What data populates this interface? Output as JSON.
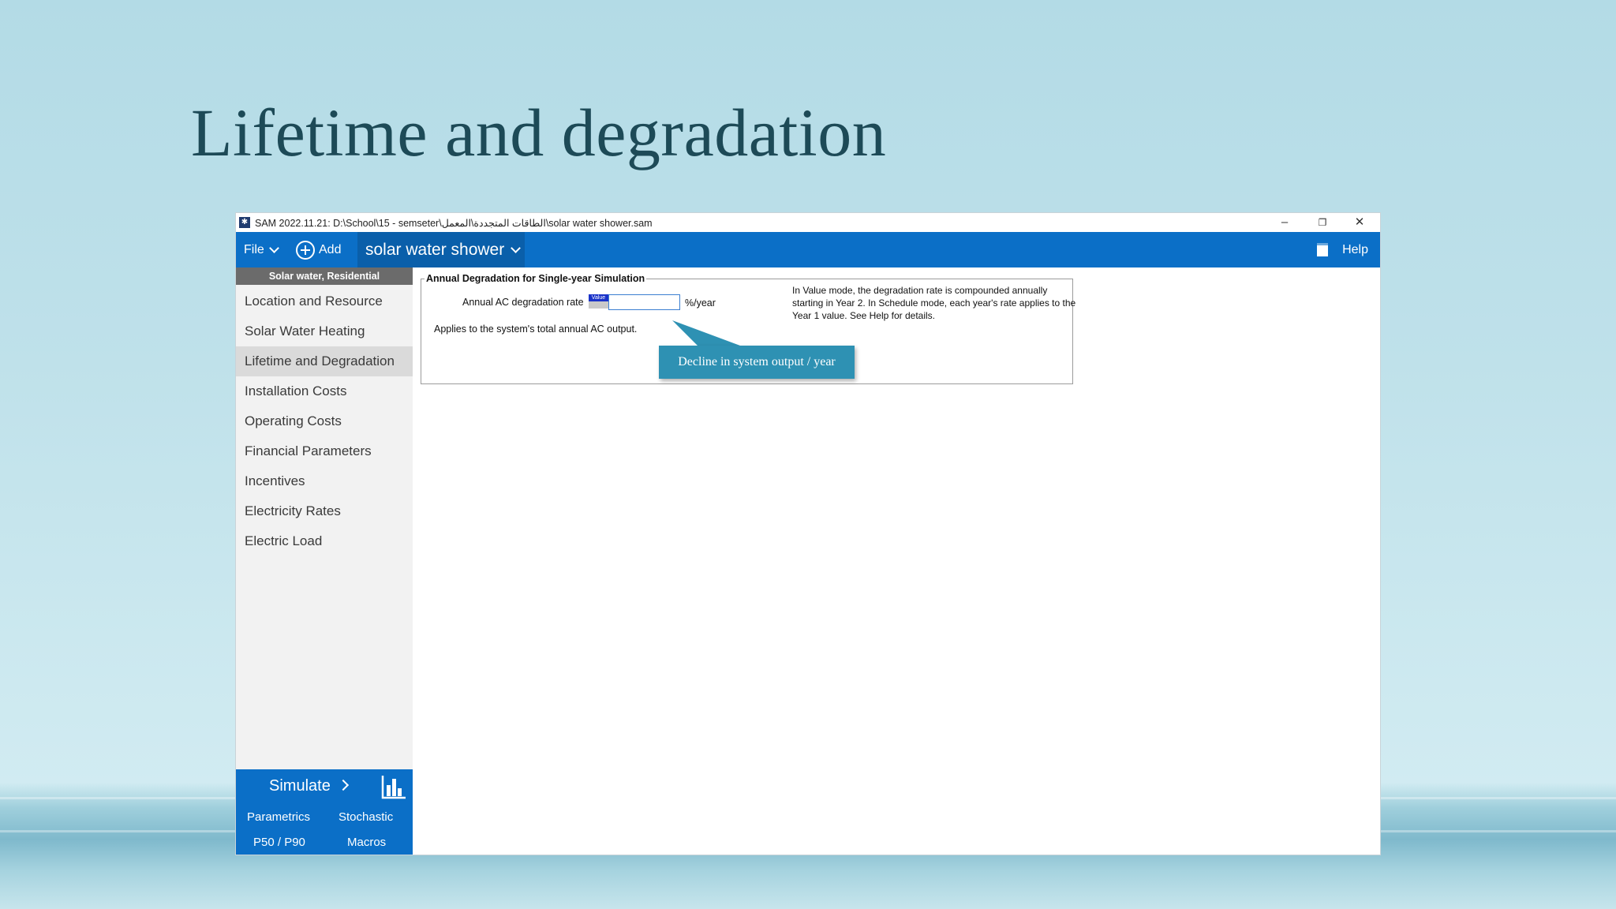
{
  "slide": {
    "title": "Lifetime and degradation"
  },
  "window": {
    "title": "SAM 2022.11.21: D:\\School\\15 - semseter\\الطاقات المتجددة\\المعمل\\solar water shower.sam",
    "controls": {
      "minimize": "–",
      "restore": "❐",
      "close": "✕"
    }
  },
  "menubar": {
    "file": "File",
    "add": "Add",
    "case_name": "solar water shower",
    "help": "Help"
  },
  "sidebar": {
    "header": "Solar water, Residential",
    "items": [
      {
        "label": "Location and Resource"
      },
      {
        "label": "Solar Water Heating"
      },
      {
        "label": "Lifetime and Degradation"
      },
      {
        "label": "Installation Costs"
      },
      {
        "label": "Operating Costs"
      },
      {
        "label": "Financial Parameters"
      },
      {
        "label": "Incentives"
      },
      {
        "label": "Electricity Rates"
      },
      {
        "label": "Electric Load"
      }
    ],
    "active_index": 2,
    "simulate": {
      "label": "Simulate",
      "parametrics": "Parametrics",
      "stochastic": "Stochastic",
      "p50p90": "P50 / P90",
      "macros": "Macros"
    }
  },
  "panel": {
    "group_title": "Annual Degradation for Single-year Simulation",
    "field_label": "Annual AC degradation rate",
    "mode_tag": "Value",
    "field_value": "",
    "unit": "%/year",
    "applies_note": "Applies to the system's total annual AC output.",
    "info_note": "In Value mode, the degradation rate is compounded annually starting in Year 2. In Schedule mode, each year's rate applies to the Year 1 value. See Help for details."
  },
  "callout": {
    "text": "Decline in system output / year"
  },
  "colors": {
    "accent": "#0b6fc7",
    "callout": "#2e91b3",
    "sidebar_header": "#6b6b6b",
    "title": "#1d4a57"
  }
}
